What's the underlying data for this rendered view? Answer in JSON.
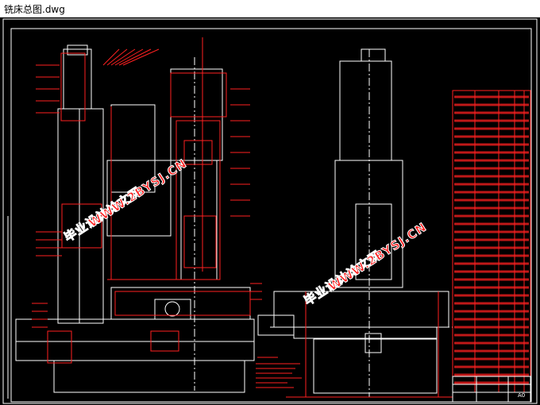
{
  "window": {
    "title": "铣床总图.dwg"
  },
  "watermarks": [
    {
      "text": "毕业设计论文网"
    },
    {
      "text": "WWW.2BYSJ.CN"
    },
    {
      "text": "毕业设计论文网"
    },
    {
      "text": "WWW.2BYSJ.CN"
    }
  ],
  "title_block": {
    "sheet_size": "A0"
  },
  "colors": {
    "background": "#000000",
    "outline": "#ffffff",
    "detail": "#ff2020",
    "watermark": "#ff1e1e"
  }
}
